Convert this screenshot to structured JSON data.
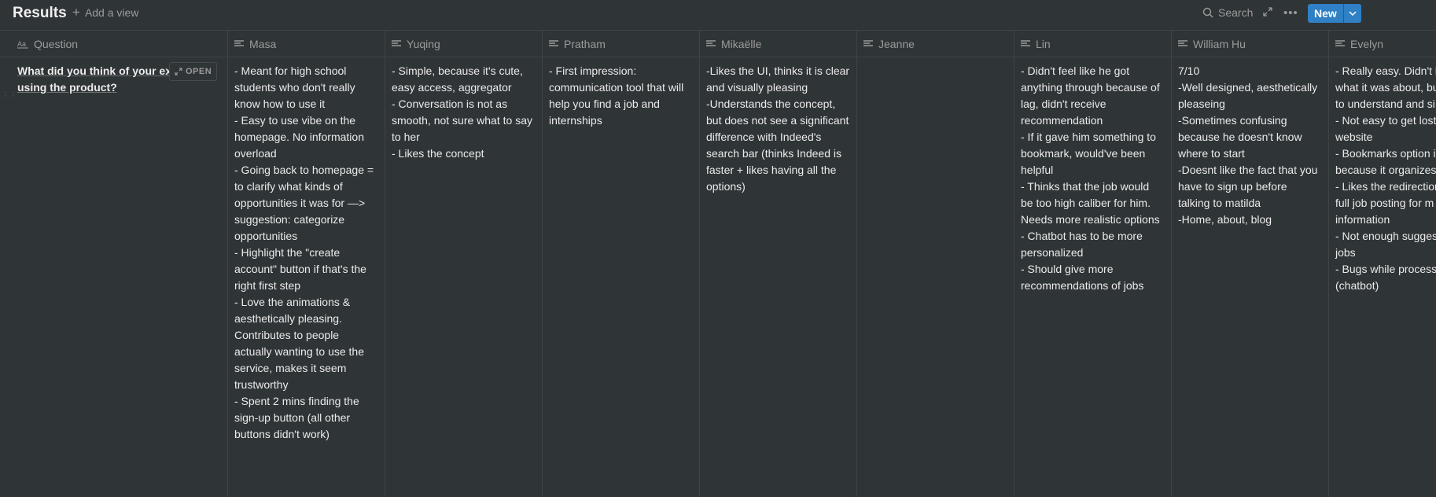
{
  "header": {
    "title": "Results",
    "add_view_label": "Add a view",
    "search_label": "Search",
    "new_label": "New"
  },
  "icons": {
    "add": "plus-icon",
    "search": "search-icon",
    "expand": "expand-icon",
    "more": "more-icon",
    "caret": "chevron-down-icon",
    "text_property": "text-lines-icon",
    "title_property": "title-aa-icon",
    "open": "open-arrows-icon"
  },
  "colors": {
    "background": "#2f3437",
    "accent": "#2f80c4",
    "muted_text": "#9b9b9b",
    "border": "#3f4447"
  },
  "columns": [
    {
      "label": "Question",
      "value": "What did you think of your exp\nusing the product?"
    },
    {
      "label": "Masa",
      "value": "- Meant for high school\nstudents who don't really\nknow how to use it\n- Easy to use vibe on the\nhomepage. No information\noverload\n- Going back to homepage =\nto clarify what kinds of\nopportunities it was for —>\nsuggestion: categorize\nopportunities\n- Highlight the \"create\naccount\" button if that's the\nright first step\n- Love the animations &\naesthetically pleasing.\nContributes to people\nactually wanting to use the\nservice, makes it seem\ntrustworthy\n- Spent 2 mins finding the\nsign-up button (all other\nbuttons didn't work)"
    },
    {
      "label": "Yuqing",
      "value": "- Simple, because it's cute,\neasy access, aggregator\n- Conversation is not as\nsmooth, not sure what to say\nto her\n- Likes the concept"
    },
    {
      "label": "Pratham",
      "value": "- First impression:\ncommunication tool that will\nhelp you find a job and\ninternships"
    },
    {
      "label": "Mikaëlle",
      "value": "-Likes the UI, thinks it is clear\nand visually pleasing\n-Understands the concept,\nbut does not see a significant\ndifference with Indeed's\nsearch bar (thinks Indeed is\nfaster + likes having all the\noptions)"
    },
    {
      "label": "Jeanne",
      "value": ""
    },
    {
      "label": "Lin",
      "value": "- Didn't feel like he got\nanything through because of\nlag, didn't receive\nrecommendation\n- If it gave him something to\nbookmark, would've been\nhelpful\n- Thinks that the job would\nbe too high caliber for him.\nNeeds more realistic options\n- Chatbot has to be more\npersonalized\n- Should give more\nrecommendations of jobs"
    },
    {
      "label": "William Hu",
      "value": "7/10\n-Well designed, aesthetically\npleaseing\n-Sometimes confusing\nbecause he doesn't know\nwhere to start\n-Doesnt like the fact that you\nhave to sign up before\ntalking to matilda\n-Home, about, blog"
    },
    {
      "label": "Evelyn",
      "value": "- Really easy. Didn't k\nwhat it was about, bu\nto understand and si\n- Not easy to get lost\nwebsite\n- Bookmarks option i\nbecause it organizes \n- Likes the redirection\nfull job posting for m\ninformation\n- Not enough sugges\njobs\n- Bugs while processi\n(chatbot)"
    }
  ],
  "open_label": "OPEN"
}
